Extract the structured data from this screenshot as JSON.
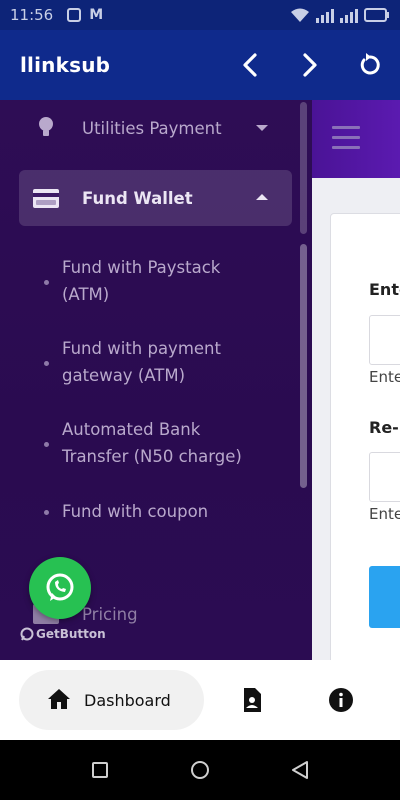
{
  "status_bar": {
    "time": "11:56"
  },
  "app_bar": {
    "title": "llinksub",
    "back_icon": "chevron-left-icon",
    "forward_icon": "chevron-right-icon",
    "refresh_icon": "refresh-icon",
    "color": "#0f2a8c"
  },
  "drawer": {
    "background": "#2e0d55",
    "utilities": {
      "label": "Utilities Payment",
      "icon": "lightbulb-icon"
    },
    "fund_wallet": {
      "label": "Fund Wallet",
      "icon": "credit-card-icon",
      "expanded": true
    },
    "sub_items": [
      {
        "line1": "Fund with Paystack",
        "line2": "(ATM)"
      },
      {
        "line1": "Fund with payment",
        "line2": "gateway (ATM)"
      },
      {
        "line1": "Automated Bank",
        "line2": "Transfer (N50 charge)"
      },
      {
        "line1": "Fund with coupon",
        "line2": ""
      }
    ],
    "pricing": {
      "label": "Pricing",
      "icon": "price-tag-icon"
    }
  },
  "main": {
    "field1": {
      "label": "Ente",
      "help": "Ente"
    },
    "field2": {
      "label": "Re-",
      "help": "Ente"
    },
    "accent": "#2aa3f0"
  },
  "whatsapp": {
    "badge": "GetButton",
    "color": "#27c152"
  },
  "bottom_nav": {
    "dashboard": {
      "label": "Dashboard",
      "icon": "home-icon"
    },
    "profile_icon": "contact-card-icon",
    "info_icon": "info-icon"
  }
}
